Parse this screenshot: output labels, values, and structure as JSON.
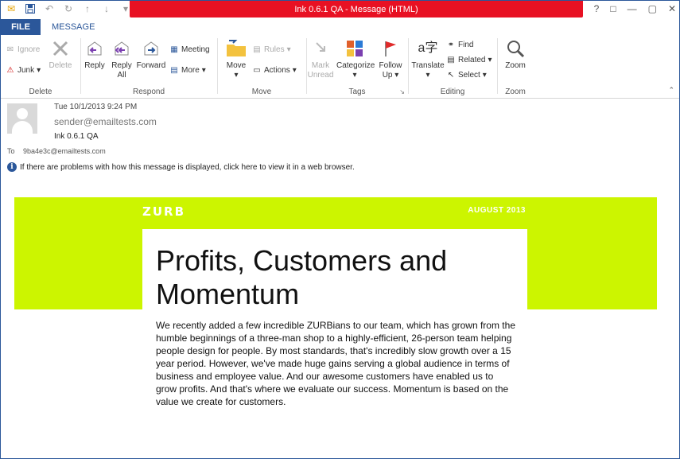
{
  "window": {
    "title": "Ink 0.6.1 QA  -  Message (HTML)",
    "controls": [
      "?",
      "□",
      "—",
      "▢",
      "✕"
    ]
  },
  "tabs": {
    "file": "FILE",
    "message": "MESSAGE"
  },
  "ribbon": {
    "delete": {
      "ignore": "Ignore",
      "junk": "Junk",
      "delete": "Delete",
      "label": "Delete"
    },
    "respond": {
      "reply": "Reply",
      "reply_all_1": "Reply",
      "reply_all_2": "All",
      "forward": "Forward",
      "meeting": "Meeting",
      "more": "More",
      "label": "Respond"
    },
    "move": {
      "move_1": "Move",
      "move_2": "▾",
      "rules": "Rules",
      "actions": "Actions",
      "label": "Move"
    },
    "tags": {
      "mark_unread_1": "Mark",
      "mark_unread_2": "Unread",
      "categorize_1": "Categorize",
      "categorize_2": "▾",
      "follow_up_1": "Follow",
      "follow_up_2": "Up ▾",
      "label": "Tags"
    },
    "editing": {
      "translate_1": "Translate",
      "translate_2": "▾",
      "find": "Find",
      "related": "Related",
      "select": "Select",
      "label": "Editing"
    },
    "zoom": {
      "zoom": "Zoom",
      "label": "Zoom"
    }
  },
  "header": {
    "date": "Tue 10/1/2013 9:24 PM",
    "sender": "sender@emailtests.com",
    "subject": "Ink 0.6.1 QA",
    "to_label": "To",
    "to_value": "9ba4e3c@emailtests.com",
    "info": "If there are problems with how this message is displayed, click here to view it in a web browser."
  },
  "email": {
    "logo": "ZURB",
    "month": "AUGUST 2013",
    "headline": "Profits, Customers and Momentum",
    "body": "We recently added a few incredible ZURBians to our team, which has grown from the humble beginnings of a three-man shop to a highly-efficient, 26-person team helping people design for people. By most standards, that's incredibly slow growth over a 15 year period. However, we've made huge gains serving a global audience in terms of business and employee value. And our awesome customers have enabled us to grow profits. And that's where we evaluate our success. Momentum is based on the value we create for customers."
  },
  "colors": {
    "accent": "#2b579a",
    "title_red": "#e81123",
    "lime": "#ccf500"
  }
}
